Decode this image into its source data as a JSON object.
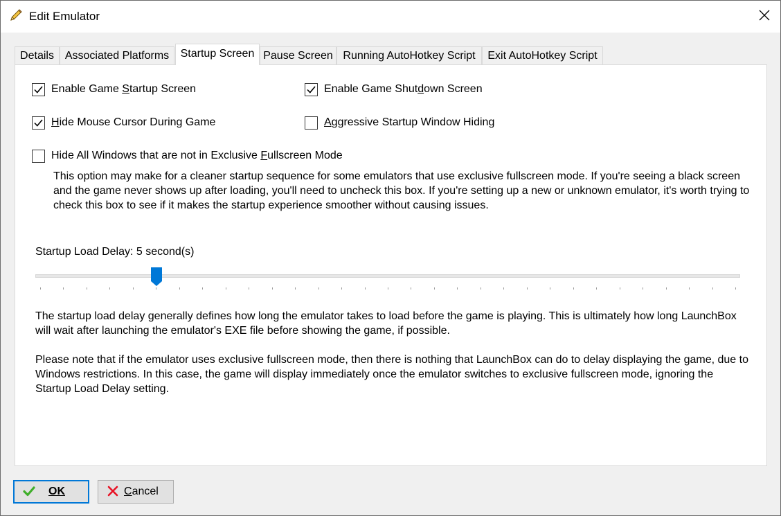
{
  "window": {
    "title": "Edit Emulator"
  },
  "tabs": [
    {
      "label": "Details",
      "active": false
    },
    {
      "label": "Associated Platforms",
      "active": false
    },
    {
      "label": "Startup Screen",
      "active": true
    },
    {
      "label": "Pause Screen",
      "active": false
    },
    {
      "label": "Running AutoHotkey Script",
      "active": false
    },
    {
      "label": "Exit AutoHotkey Script",
      "active": false
    }
  ],
  "startup": {
    "enable_startup": {
      "checked": true,
      "pre": "Enable Game ",
      "key": "S",
      "post": "tartup Screen"
    },
    "enable_shutdown": {
      "checked": true,
      "pre": "Enable Game Shut",
      "key": "d",
      "post": "own Screen"
    },
    "hide_cursor": {
      "checked": true,
      "pre": "",
      "key": "H",
      "post": "ide Mouse Cursor During Game"
    },
    "aggressive_hiding": {
      "checked": false,
      "pre": "",
      "key": "A",
      "post": "ggressive Startup Window Hiding"
    },
    "hide_windows": {
      "checked": false,
      "pre": "Hide All Windows that are not in Exclusive ",
      "key": "F",
      "post": "ullscreen Mode"
    },
    "hide_windows_desc": "This option may make for a cleaner startup sequence for some emulators that use exclusive fullscreen mode. If you're seeing a black screen and the game never shows up after loading, you'll need to uncheck this box. If you're setting up a new or unknown emulator, it's worth trying to check this box to see if it makes the startup experience smoother without causing issues.",
    "delay_label": "Startup Load Delay: 5 second(s)",
    "delay_seconds": 5,
    "delay_paragraph_1": "The startup load delay generally defines how long the emulator takes to load before the game is playing. This is ultimately how long LaunchBox will wait after launching the emulator's EXE file before showing the game, if possible.",
    "delay_paragraph_2": "Please note that if the emulator uses exclusive fullscreen mode, then there is nothing that LaunchBox can do to delay displaying the game, due to Windows restrictions. In this case, the game will display immediately once the emulator switches to exclusive fullscreen mode, ignoring the Startup Load Delay setting."
  },
  "buttons": {
    "ok": {
      "label": "OK",
      "icon": "checkmark-icon"
    },
    "cancel": {
      "pre": "",
      "key": "C",
      "post": "ancel",
      "icon": "x-icon"
    }
  },
  "colors": {
    "accent": "#0078d7",
    "ok_icon": "#3fae2a",
    "cancel_icon": "#e81123"
  }
}
